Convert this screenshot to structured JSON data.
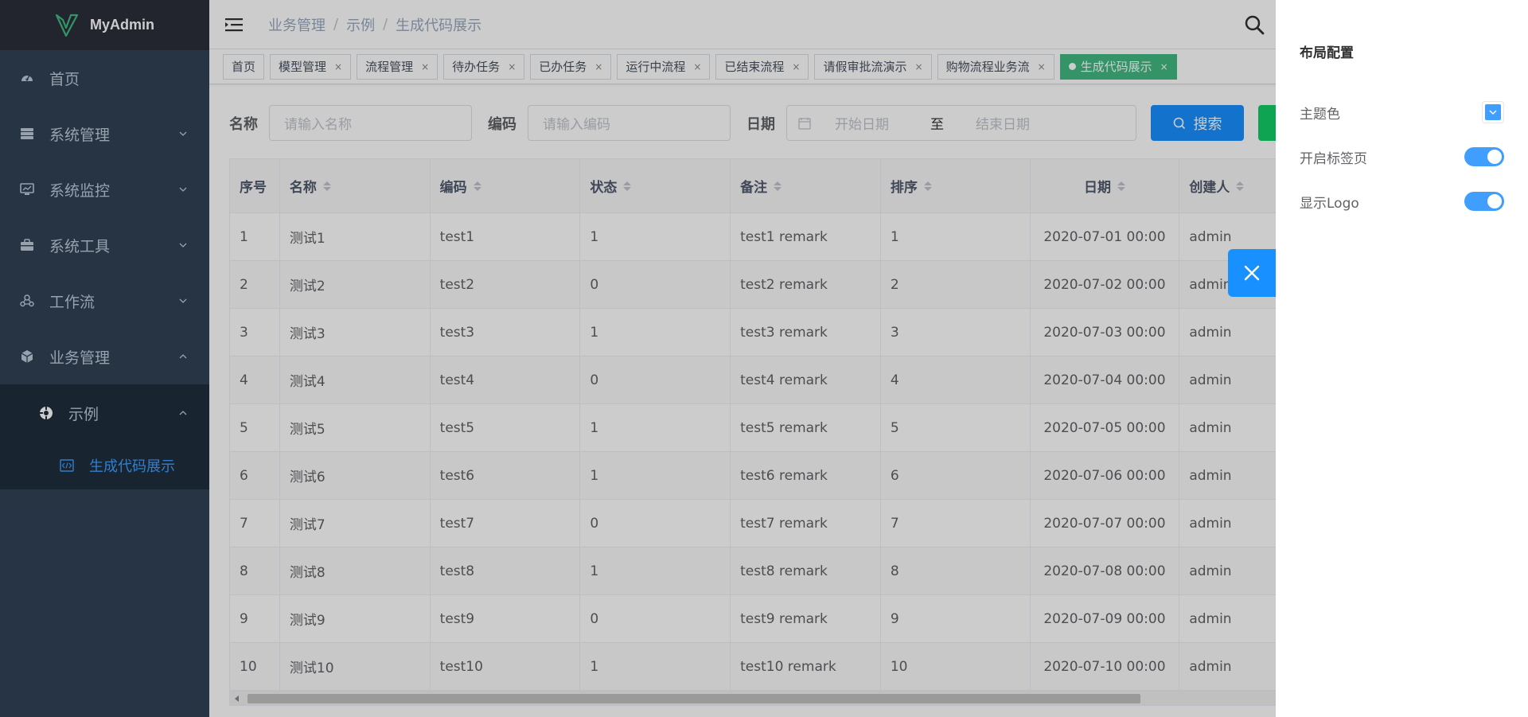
{
  "app": {
    "logo_text": "MyAdmin"
  },
  "sidebar": {
    "items": [
      {
        "label": "首页",
        "icon": "dashboard-icon"
      },
      {
        "label": "系统管理",
        "icon": "system-icon"
      },
      {
        "label": "系统监控",
        "icon": "monitor-icon"
      },
      {
        "label": "系统工具",
        "icon": "tool-icon"
      },
      {
        "label": "工作流",
        "icon": "workflow-icon"
      },
      {
        "label": "业务管理",
        "icon": "business-icon"
      }
    ],
    "sub": {
      "label": "示例",
      "icon": "example-icon"
    },
    "leaf": {
      "label": "生成代码展示",
      "icon": "code-icon"
    }
  },
  "breadcrumb": [
    "业务管理",
    "示例",
    "生成代码展示"
  ],
  "tags": [
    {
      "label": "首页",
      "closable": false
    },
    {
      "label": "模型管理",
      "closable": true
    },
    {
      "label": "流程管理",
      "closable": true
    },
    {
      "label": "待办任务",
      "closable": true
    },
    {
      "label": "已办任务",
      "closable": true
    },
    {
      "label": "运行中流程",
      "closable": true
    },
    {
      "label": "已结束流程",
      "closable": true
    },
    {
      "label": "请假审批流演示",
      "closable": true
    },
    {
      "label": "购物流程业务流",
      "closable": true
    },
    {
      "label": "生成代码展示",
      "closable": true,
      "active": true
    }
  ],
  "search": {
    "name_label": "名称",
    "name_placeholder": "请输入名称",
    "code_label": "编码",
    "code_placeholder": "请输入编码",
    "date_label": "日期",
    "start_placeholder": "开始日期",
    "range_sep": "至",
    "end_placeholder": "结束日期",
    "search_btn": "搜索"
  },
  "table": {
    "headers": [
      "序号",
      "名称",
      "编码",
      "状态",
      "备注",
      "排序",
      "日期",
      "创建人"
    ],
    "rows": [
      [
        "1",
        "测试1",
        "test1",
        "1",
        "test1 remark",
        "1",
        "2020-07-01 00:00",
        "admin"
      ],
      [
        "2",
        "测试2",
        "test2",
        "0",
        "test2 remark",
        "2",
        "2020-07-02 00:00",
        "admin"
      ],
      [
        "3",
        "测试3",
        "test3",
        "1",
        "test3 remark",
        "3",
        "2020-07-03 00:00",
        "admin"
      ],
      [
        "4",
        "测试4",
        "test4",
        "0",
        "test4 remark",
        "4",
        "2020-07-04 00:00",
        "admin"
      ],
      [
        "5",
        "测试5",
        "test5",
        "1",
        "test5 remark",
        "5",
        "2020-07-05 00:00",
        "admin"
      ],
      [
        "6",
        "测试6",
        "test6",
        "1",
        "test6 remark",
        "6",
        "2020-07-06 00:00",
        "admin"
      ],
      [
        "7",
        "测试7",
        "test7",
        "0",
        "test7 remark",
        "7",
        "2020-07-07 00:00",
        "admin"
      ],
      [
        "8",
        "测试8",
        "test8",
        "1",
        "test8 remark",
        "8",
        "2020-07-08 00:00",
        "admin"
      ],
      [
        "9",
        "测试9",
        "test9",
        "0",
        "test9 remark",
        "9",
        "2020-07-09 00:00",
        "admin"
      ],
      [
        "10",
        "测试10",
        "test10",
        "1",
        "test10 remark",
        "10",
        "2020-07-10 00:00",
        "admin"
      ]
    ]
  },
  "drawer": {
    "title": "布局配置",
    "theme_label": "主题色",
    "theme_color": "#409eff",
    "tags_label": "开启标签页",
    "tags_on": true,
    "logo_label": "显示Logo",
    "logo_on": true
  },
  "colors": {
    "sidebar": "#304156",
    "accent": "#409eff",
    "active_tag": "#42b983"
  }
}
